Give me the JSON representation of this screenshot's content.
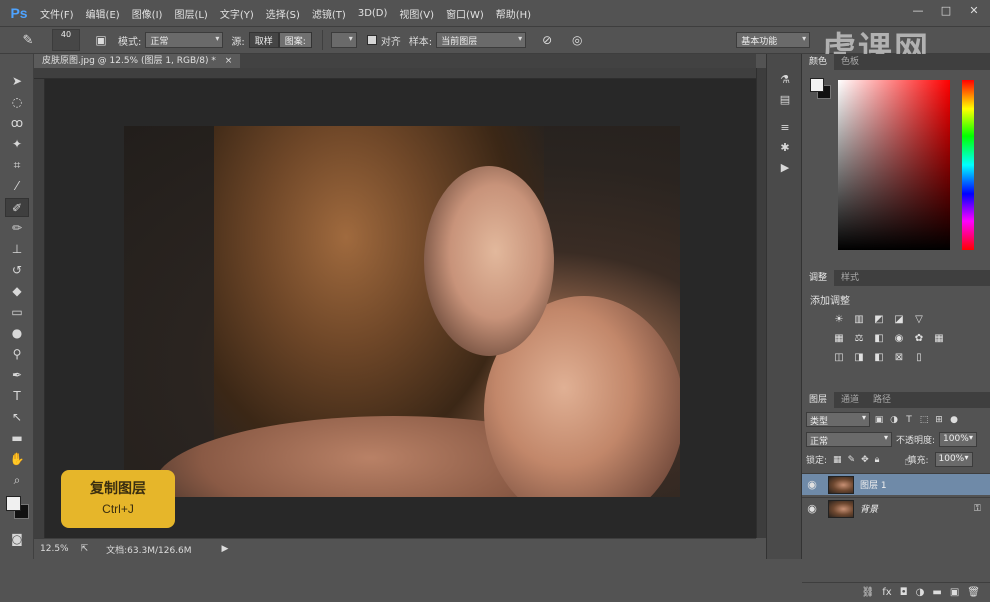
{
  "app": {
    "logo": "Ps"
  },
  "menu": [
    "文件(F)",
    "编辑(E)",
    "图像(I)",
    "图层(L)",
    "文字(Y)",
    "选择(S)",
    "滤镜(T)",
    "3D(D)",
    "视图(V)",
    "窗口(W)",
    "帮助(H)"
  ],
  "window": {
    "minimize": "—",
    "restore": "□",
    "close": "✕"
  },
  "watermark": "虎课网",
  "options": {
    "brush_size": "40",
    "mode_label": "模式:",
    "mode_value": "正常",
    "source_label": "源:",
    "sampled": "取样",
    "pattern": "图案:",
    "aligned_label": "对齐",
    "sample_label": "样本:",
    "sample_value": "当前图层"
  },
  "workspace_select": "基本功能",
  "document": {
    "tab": "皮肤原图.jpg @ 12.5% (图层 1, RGB/8) *",
    "close": "×"
  },
  "hint": {
    "title": "复制图层",
    "keys": "Ctrl+J"
  },
  "status": {
    "zoom": "12.5%",
    "doc": "文档:63.3M/126.6M"
  },
  "panels": {
    "color_tabs": [
      "颜色",
      "色板"
    ],
    "adjust_tabs": [
      "调整",
      "样式"
    ],
    "adjust_title": "添加调整",
    "layers_tabs": [
      "图层",
      "通道",
      "路径"
    ],
    "filter_kind": "类型",
    "blend_mode": "正常",
    "opacity_label": "不透明度:",
    "opacity": "100%",
    "lock_label": "锁定:",
    "fill_label": "填充:",
    "fill": "100%",
    "layers": [
      {
        "name": "图层 1",
        "selected": true
      },
      {
        "name": "背景",
        "selected": false
      }
    ]
  }
}
